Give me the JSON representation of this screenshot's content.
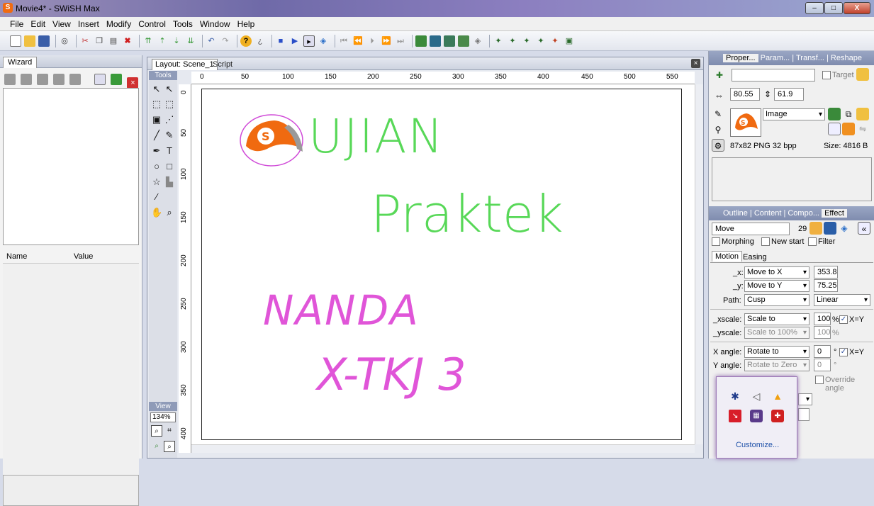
{
  "window": {
    "title": "Movie4* - SWiSH Max",
    "minimize": "–",
    "maximize": "□",
    "close": "X"
  },
  "menu": [
    "File",
    "Edit",
    "View",
    "Insert",
    "Modify",
    "Control",
    "Tools",
    "Window",
    "Help"
  ],
  "left_panel": {
    "tab": "Wizard",
    "props_header": {
      "name": "Name",
      "value": "Value"
    }
  },
  "layout": {
    "tabs": [
      "Layout: Scene_1",
      "Script"
    ],
    "tools_label": "Tools",
    "view_label": "View",
    "zoom": "134%",
    "ruler_top": [
      "0",
      "50",
      "100",
      "150",
      "200",
      "250",
      "300",
      "350",
      "400",
      "450",
      "500",
      "550"
    ],
    "ruler_left": [
      "0",
      "50",
      "100",
      "150",
      "200",
      "250",
      "300",
      "350",
      "400"
    ],
    "canvas_text": {
      "line1": "UJIAN",
      "line2": "Praktek",
      "line3": "NANDA",
      "line4": "X-TKJ 3"
    }
  },
  "properties": {
    "tabs": [
      "Proper...",
      "Param...",
      "Transf...",
      "Reshape"
    ],
    "target_label": "Target",
    "width": "80.55",
    "height": "61.9",
    "type": "Image",
    "image_info": "87x82 PNG 32 bpp",
    "size": "Size: 4816 B"
  },
  "effect": {
    "tabs": [
      "Outline",
      "Content",
      "Compo...",
      "Effect"
    ],
    "name": "Move",
    "frames": "29",
    "morphing": "Morphing",
    "new_start": "New start",
    "filter": "Filter",
    "subtabs": [
      "Motion",
      "Easing"
    ],
    "x_label": "_x:",
    "x_mode": "Move to X",
    "x_value": "353.8",
    "y_label": "_y:",
    "y_mode": "Move to Y",
    "y_value": "75.25",
    "path_label": "Path:",
    "path_mode": "Cusp",
    "path_interp": "Linear",
    "xscale_label": "_xscale:",
    "xscale_mode": "Scale to",
    "xscale_value": "100",
    "yscale_label": "_yscale:",
    "yscale_mode": "Scale to 100%",
    "yscale_value": "100",
    "pct": "%",
    "xy_label": "X=Y",
    "xangle_label": "X angle:",
    "xangle_mode": "Rotate to",
    "xangle_value": "0",
    "deg": "°",
    "yangle_label": "Y angle:",
    "yangle_mode": "Rotate to Zero",
    "yangle_value": "0",
    "override": "Override angle"
  },
  "tray": {
    "customize": "Customize..."
  },
  "colors": {
    "green_text": "#58d858",
    "pink_text": "#e055d8",
    "swish_orange": "#f06a10"
  }
}
